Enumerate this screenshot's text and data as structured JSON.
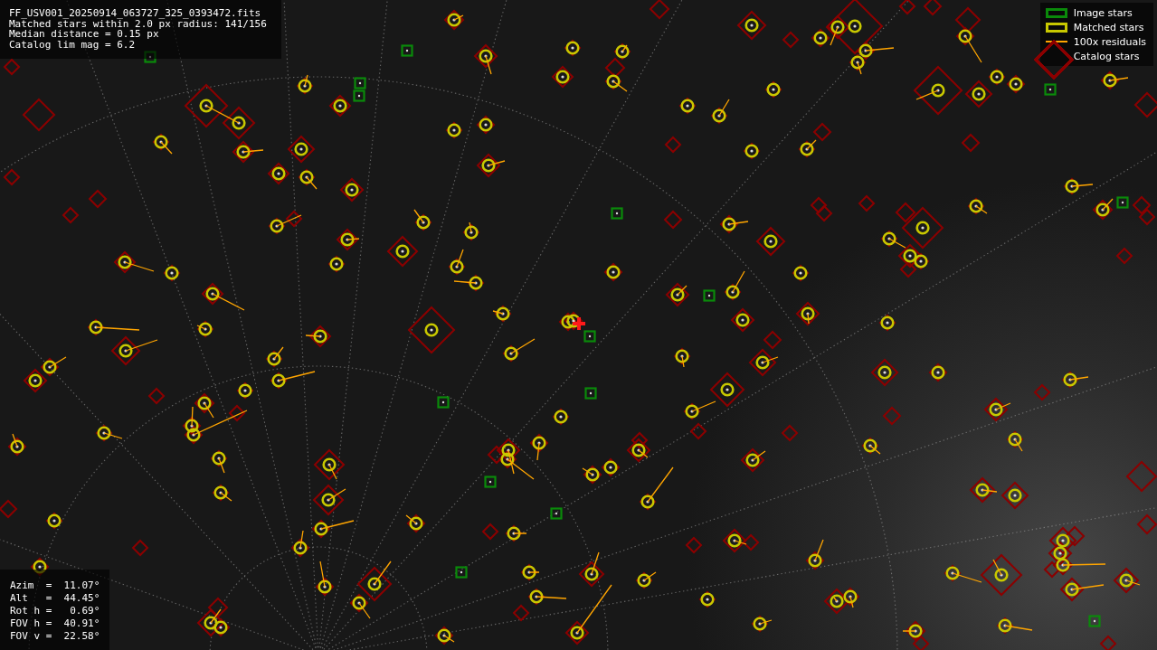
{
  "header": {
    "lines": [
      "FF_USV001_20250914_063727_325_0393472.fits",
      "Matched stars within 2.0 px radius: 141/156",
      "Median distance = 0.15 px",
      "Catalog lim mag = 6.2"
    ]
  },
  "pointing": {
    "lines": [
      "Azim  =  11.07°",
      "Alt   =  44.45°",
      "Rot h =   0.69°",
      "FOV h =  40.91°",
      "FOV v =  22.58°"
    ]
  },
  "legend": [
    {
      "kind": "box",
      "color": "#0a8a0a",
      "label": "Image stars"
    },
    {
      "kind": "box",
      "color": "#c8c800",
      "label": "Matched stars"
    },
    {
      "kind": "line",
      "color": "#ffa500",
      "label": "100x residuals"
    },
    {
      "kind": "diamond",
      "color": "#8b0000",
      "label": "Catalog stars"
    }
  ]
}
